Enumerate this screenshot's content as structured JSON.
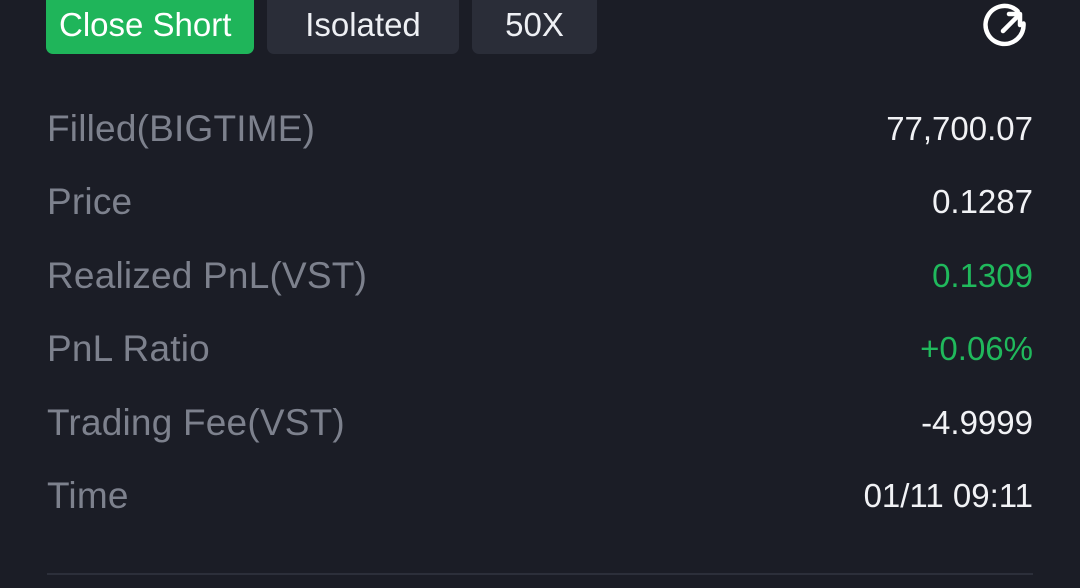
{
  "tags": {
    "direction": "Close Short",
    "margin_mode": "Isolated",
    "leverage": "50X"
  },
  "share_icon": "share-icon",
  "details": [
    {
      "label": "Filled(BIGTIME)",
      "value": "77,700.07",
      "tone": "neutral"
    },
    {
      "label": "Price",
      "value": "0.1287",
      "tone": "neutral"
    },
    {
      "label": "Realized PnL(VST)",
      "value": "0.1309",
      "tone": "positive"
    },
    {
      "label": "PnL Ratio",
      "value": "+0.06%",
      "tone": "positive"
    },
    {
      "label": "Trading Fee(VST)",
      "value": "-4.9999",
      "tone": "neutral"
    },
    {
      "label": "Time",
      "value": "01/11 09:11",
      "tone": "neutral"
    }
  ],
  "colors": {
    "background": "#1b1d26",
    "tag_background": "#2a2d38",
    "positive": "#20b95c",
    "direction_tag": "#1fb55a",
    "label": "#7d818d",
    "value": "#f1f2f5"
  }
}
